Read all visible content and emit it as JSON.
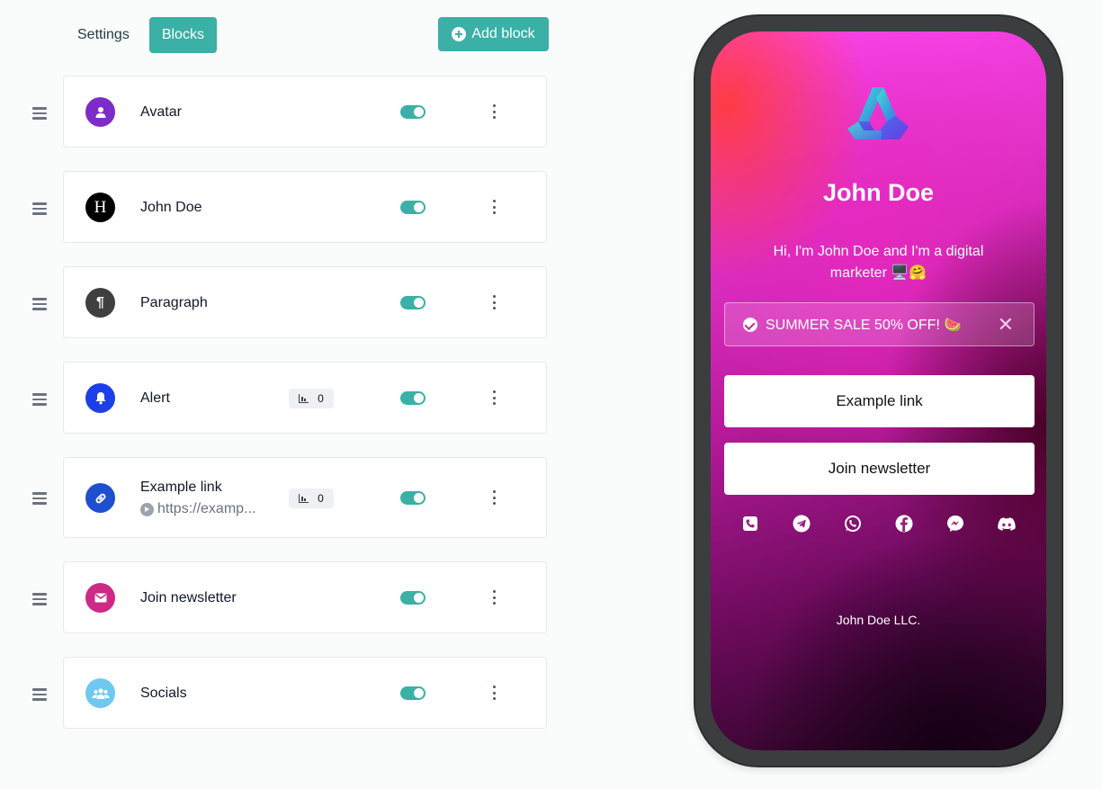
{
  "tabs": [
    {
      "label": "Settings",
      "active": false
    },
    {
      "label": "Blocks",
      "active": true
    }
  ],
  "add_block_label": "Add block",
  "blocks": [
    {
      "name": "Avatar",
      "icon": "user-icon",
      "icon_color": "#7e2cc8",
      "enabled": true
    },
    {
      "name": "John Doe",
      "icon": "heading-icon",
      "icon_glyph": "H",
      "icon_color": "#000000",
      "enabled": true
    },
    {
      "name": "Paragraph",
      "icon": "paragraph-icon",
      "icon_glyph": "¶",
      "icon_color": "#3f3f3f",
      "enabled": true
    },
    {
      "name": "Alert",
      "icon": "bell-icon",
      "icon_color": "#1d3fe8",
      "enabled": true,
      "clicks": "0"
    },
    {
      "name": "Example link",
      "url": "https://examp...",
      "icon": "link-icon",
      "icon_color": "#1d4fd0",
      "enabled": true,
      "clicks": "0"
    },
    {
      "name": "Join newsletter",
      "icon": "envelope-icon",
      "icon_color": "#cc2a86",
      "enabled": true
    },
    {
      "name": "Socials",
      "icon": "users-icon",
      "icon_color": "#6fc8f0",
      "enabled": true
    }
  ],
  "preview": {
    "name": "John Doe",
    "bio": "Hi, I'm John Doe and I'm a digital marketer 🖥️🤗",
    "alert": "SUMMER SALE 50% OFF! 🍉",
    "links": [
      "Example link",
      "Join newsletter"
    ],
    "socials": [
      "phone-icon",
      "telegram-icon",
      "whatsapp-icon",
      "facebook-icon",
      "messenger-icon",
      "discord-icon"
    ],
    "footer": "John Doe LLC."
  },
  "colors": {
    "accent": "#3ab0a6"
  }
}
